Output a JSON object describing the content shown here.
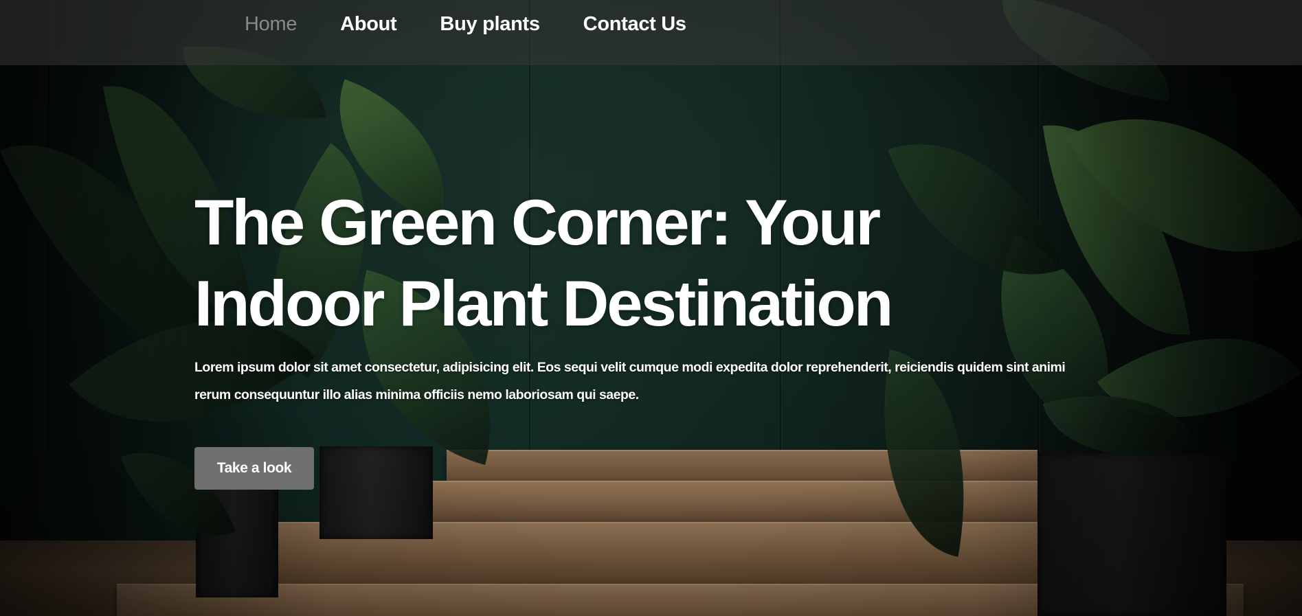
{
  "nav": {
    "items": [
      {
        "label": "Home",
        "active": true
      },
      {
        "label": "About",
        "active": false
      },
      {
        "label": "Buy plants",
        "active": false
      },
      {
        "label": "Contact Us",
        "active": false
      }
    ]
  },
  "hero": {
    "title": "The Green Corner: Your Indoor Plant Destination",
    "description": "Lorem ipsum dolor sit amet consectetur, adipisicing elit. Eos sequi velit cumque modi expedita dolor reprehenderit, reiciendis quidem sint animi rerum consequuntur illo alias minima officiis nemo laboriosam qui saepe.",
    "cta_label": "Take a look"
  },
  "colors": {
    "navbar_bg": "#373737",
    "nav_active": "#8a8a8a",
    "text": "#ffffff",
    "button_bg": "#707070"
  }
}
